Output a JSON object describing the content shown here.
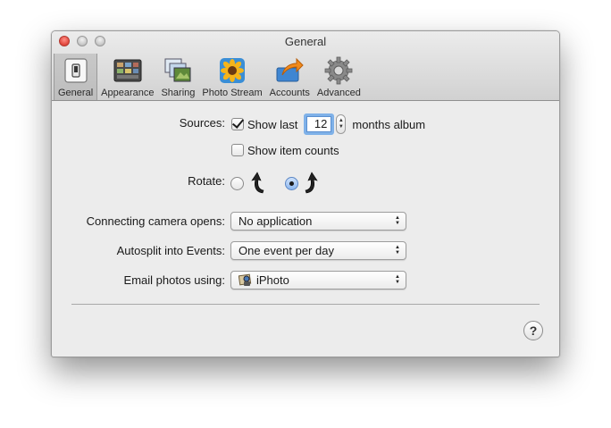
{
  "window": {
    "title": "General"
  },
  "tabs": [
    {
      "label": "General",
      "icon": "general-switch-icon",
      "selected": true
    },
    {
      "label": "Appearance",
      "icon": "appearance-icon"
    },
    {
      "label": "Sharing",
      "icon": "sharing-icon"
    },
    {
      "label": "Photo Stream",
      "icon": "photo-stream-icon"
    },
    {
      "label": "Accounts",
      "icon": "accounts-icon"
    },
    {
      "label": "Advanced",
      "icon": "gear-icon"
    }
  ],
  "sources": {
    "label": "Sources:",
    "show_last": {
      "label": "Show last",
      "checked": true
    },
    "months_value": "12",
    "months_suffix": "months album",
    "show_item_counts": {
      "label": "Show item counts",
      "checked": false
    }
  },
  "rotate": {
    "label": "Rotate:",
    "options": [
      {
        "icon": "rotate-counterclockwise-icon",
        "selected": false
      },
      {
        "icon": "rotate-clockwise-icon",
        "selected": true
      }
    ]
  },
  "connecting_camera": {
    "label": "Connecting camera opens:",
    "value": "No application"
  },
  "autosplit": {
    "label": "Autosplit into Events:",
    "value": "One event per day"
  },
  "email_photos": {
    "label": "Email photos using:",
    "value": "iPhoto",
    "icon": "iphoto-icon"
  },
  "help": {
    "label": "?"
  },
  "colors": {
    "focus_ring": "#7fb1e8",
    "window_bg": "#ececec"
  }
}
